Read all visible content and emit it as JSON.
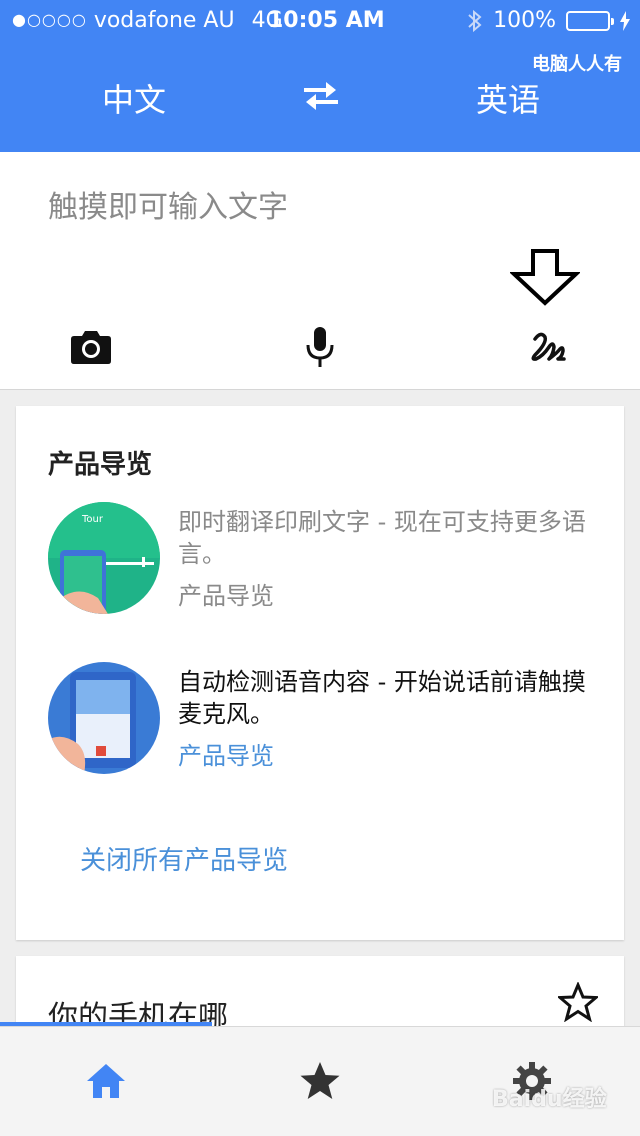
{
  "status_bar": {
    "signal": "●○○○○",
    "carrier": "vodafone AU",
    "network": "4G",
    "time": "10:05 AM",
    "battery": "100%",
    "battery_level": 1.0
  },
  "app_bar": {
    "source_language": "中文",
    "target_language": "英语",
    "watermark": "电脑人人有"
  },
  "input": {
    "placeholder": "触摸即可输入文字"
  },
  "tour_card": {
    "title": "产品导览",
    "items": [
      {
        "text": "即时翻译印刷文字 - 现在可支持更多语言。",
        "link": "产品导览"
      },
      {
        "text": "自动检测语音内容 - 开始说话前请触摸麦克风。",
        "link": "产品导览"
      }
    ],
    "close_all": "关闭所有产品导览"
  },
  "phone_card": {
    "title": "你的手机在哪"
  },
  "bottom_nav": {
    "watermark": "Baidu经验"
  },
  "colors": {
    "brand_blue": "#4285f4",
    "link_blue": "#4a90d9",
    "battery_green": "#4cd964"
  },
  "icons": [
    "bluetooth-icon",
    "swap-icon",
    "camera-icon",
    "mic-icon",
    "handwriting-icon",
    "star-outline-icon",
    "home-icon",
    "star-icon",
    "settings-icon"
  ]
}
